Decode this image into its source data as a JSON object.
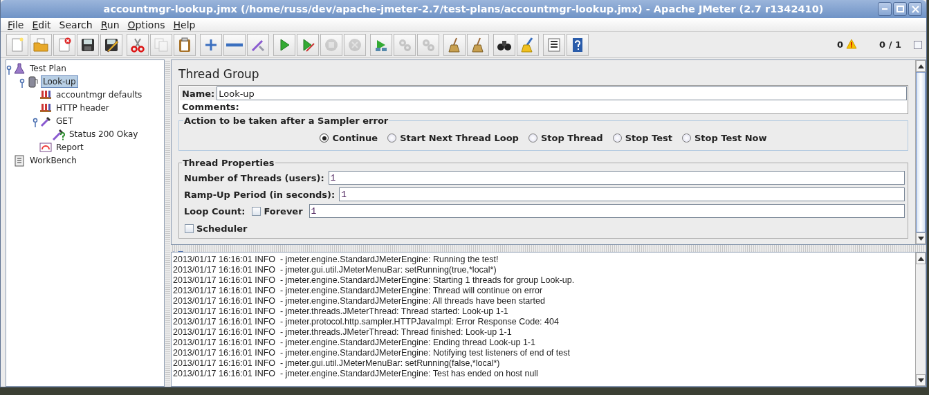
{
  "window": {
    "title": "accountmgr-lookup.jmx (/home/russ/dev/apache-jmeter-2.7/test-plans/accountmgr-lookup.jmx) - Apache JMeter (2.7 r1342410)"
  },
  "menu": [
    {
      "label": "File",
      "underlined": true
    },
    {
      "label": "Edit",
      "underlined": true
    },
    {
      "label": "Search",
      "underlined": false
    },
    {
      "label": "Run",
      "underlined": true
    },
    {
      "label": "Options",
      "underlined": true
    },
    {
      "label": "Help",
      "underlined": true
    }
  ],
  "toolbar": [
    [
      {
        "kind": "new",
        "disabled": false
      },
      {
        "kind": "open",
        "disabled": false
      },
      {
        "kind": "close",
        "disabled": false
      },
      {
        "kind": "save",
        "disabled": false
      },
      {
        "kind": "saveas",
        "disabled": false
      }
    ],
    [
      {
        "kind": "cut",
        "disabled": false
      },
      {
        "kind": "copy",
        "disabled": true
      },
      {
        "kind": "paste",
        "disabled": false
      }
    ],
    [
      {
        "kind": "plus",
        "disabled": false
      },
      {
        "kind": "minus",
        "disabled": false
      },
      {
        "kind": "toggle",
        "disabled": false
      }
    ],
    [
      {
        "kind": "start",
        "disabled": false
      },
      {
        "kind": "startnp",
        "disabled": false
      },
      {
        "kind": "stop",
        "disabled": true
      },
      {
        "kind": "shutdown",
        "disabled": true
      }
    ],
    [
      {
        "kind": "remote",
        "disabled": false
      },
      {
        "kind": "gears",
        "disabled": true
      },
      {
        "kind": "gears",
        "disabled": true
      }
    ],
    [
      {
        "kind": "broom",
        "disabled": false
      },
      {
        "kind": "broom",
        "disabled": false
      }
    ],
    [
      {
        "kind": "binoculars",
        "disabled": false
      },
      {
        "kind": "brush",
        "disabled": false
      }
    ],
    [
      {
        "kind": "list",
        "disabled": false
      },
      {
        "kind": "help",
        "disabled": false
      }
    ]
  ],
  "status": {
    "warnings": "0",
    "threads": "0 / 1"
  },
  "tree": [
    {
      "label": "Test Plan",
      "kind": "testplan",
      "selected": false,
      "expanded": true,
      "children": [
        {
          "label": "Look-up",
          "kind": "threadgroup",
          "selected": true,
          "expanded": true,
          "children": [
            {
              "label": "accountmgr defaults",
              "kind": "config",
              "selected": false
            },
            {
              "label": "HTTP header",
              "kind": "config",
              "selected": false
            },
            {
              "label": "GET",
              "kind": "sampler",
              "selected": false,
              "expanded": true,
              "children": [
                {
                  "label": "Status 200 Okay",
                  "kind": "assertion",
                  "selected": false
                }
              ]
            },
            {
              "label": "Report",
              "kind": "listener",
              "selected": false
            }
          ]
        }
      ]
    },
    {
      "label": "WorkBench",
      "kind": "workbench",
      "selected": false
    }
  ],
  "panel": {
    "title": "Thread Group",
    "name_label": "Name:",
    "name_value": "Look-up",
    "comments_label": "Comments:",
    "error_action": {
      "legend": "Action to be taken after a Sampler error",
      "options": [
        {
          "label": "Continue",
          "selected": true
        },
        {
          "label": "Start Next Thread Loop",
          "selected": false
        },
        {
          "label": "Stop Thread",
          "selected": false
        },
        {
          "label": "Stop Test",
          "selected": false
        },
        {
          "label": "Stop Test Now",
          "selected": false
        }
      ]
    },
    "thread_properties": {
      "legend": "Thread Properties",
      "threads_label": "Number of Threads (users):",
      "threads_value": "1",
      "rampup_label": "Ramp-Up Period (in seconds):",
      "rampup_value": "1",
      "loop_label": "Loop Count:",
      "forever": {
        "label": "Forever",
        "checked": false
      },
      "loop_value": "1",
      "scheduler": {
        "label": "Scheduler",
        "checked": false
      }
    }
  },
  "log": [
    "2013/01/17 16:16:01 INFO  - jmeter.engine.StandardJMeterEngine: Running the test!",
    "2013/01/17 16:16:01 INFO  - jmeter.gui.util.JMeterMenuBar: setRunning(true,*local*)",
    "2013/01/17 16:16:01 INFO  - jmeter.engine.StandardJMeterEngine: Starting 1 threads for group Look-up.",
    "2013/01/17 16:16:01 INFO  - jmeter.engine.StandardJMeterEngine: Thread will continue on error",
    "2013/01/17 16:16:01 INFO  - jmeter.engine.StandardJMeterEngine: All threads have been started",
    "2013/01/17 16:16:01 INFO  - jmeter.threads.JMeterThread: Thread started: Look-up 1-1",
    "2013/01/17 16:16:01 INFO  - jmeter.protocol.http.sampler.HTTPJavaImpl: Error Response Code: 404",
    "2013/01/17 16:16:01 INFO  - jmeter.threads.JMeterThread: Thread finished: Look-up 1-1",
    "2013/01/17 16:16:01 INFO  - jmeter.engine.StandardJMeterEngine: Ending thread Look-up 1-1",
    "2013/01/17 16:16:01 INFO  - jmeter.engine.StandardJMeterEngine: Notifying test listeners of end of test",
    "2013/01/17 16:16:01 INFO  - jmeter.gui.util.JMeterMenuBar: setRunning(false,*local*)",
    "2013/01/17 16:16:01 INFO  - jmeter.engine.StandardJMeterEngine: Test has ended on host null"
  ]
}
